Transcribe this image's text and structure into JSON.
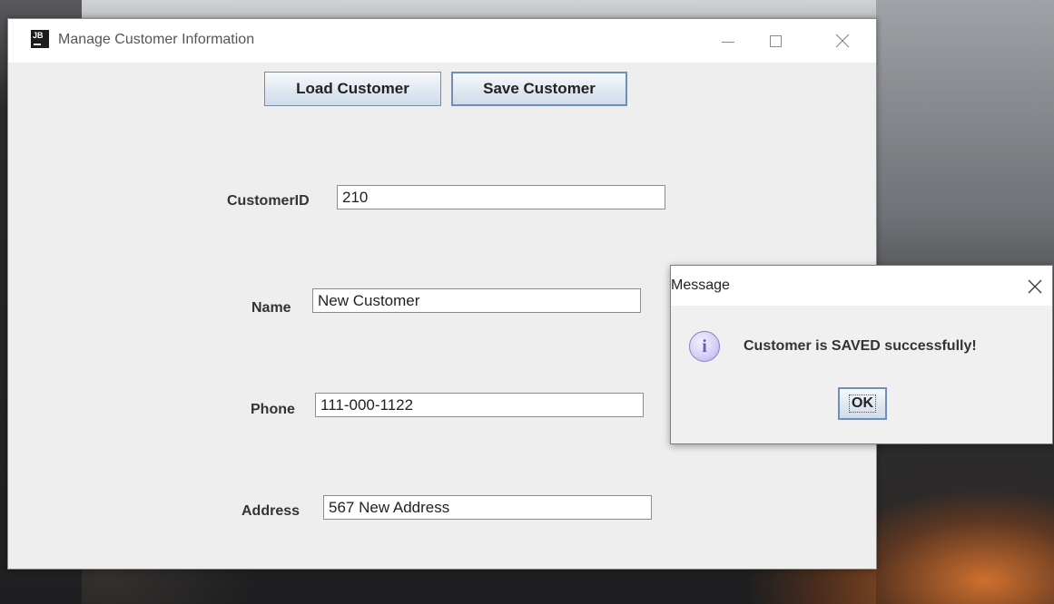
{
  "window": {
    "title": "Manage Customer Information"
  },
  "toolbar": {
    "load_label": "Load Customer",
    "save_label": "Save Customer"
  },
  "form": {
    "customer_id": {
      "label": "CustomerID",
      "value": "210"
    },
    "name": {
      "label": "Name",
      "value": "New Customer"
    },
    "phone": {
      "label": "Phone",
      "value": "111-000-1122"
    },
    "address": {
      "label": "Address",
      "value": "567 New Address"
    }
  },
  "dialog": {
    "title": "Message",
    "message": "Customer is SAVED successfully!",
    "ok_label": "OK",
    "icon": "info-icon"
  },
  "icons": {
    "app": "java-app-icon",
    "minimize": "minimize-icon",
    "maximize": "maximize-icon",
    "close": "close-icon"
  }
}
